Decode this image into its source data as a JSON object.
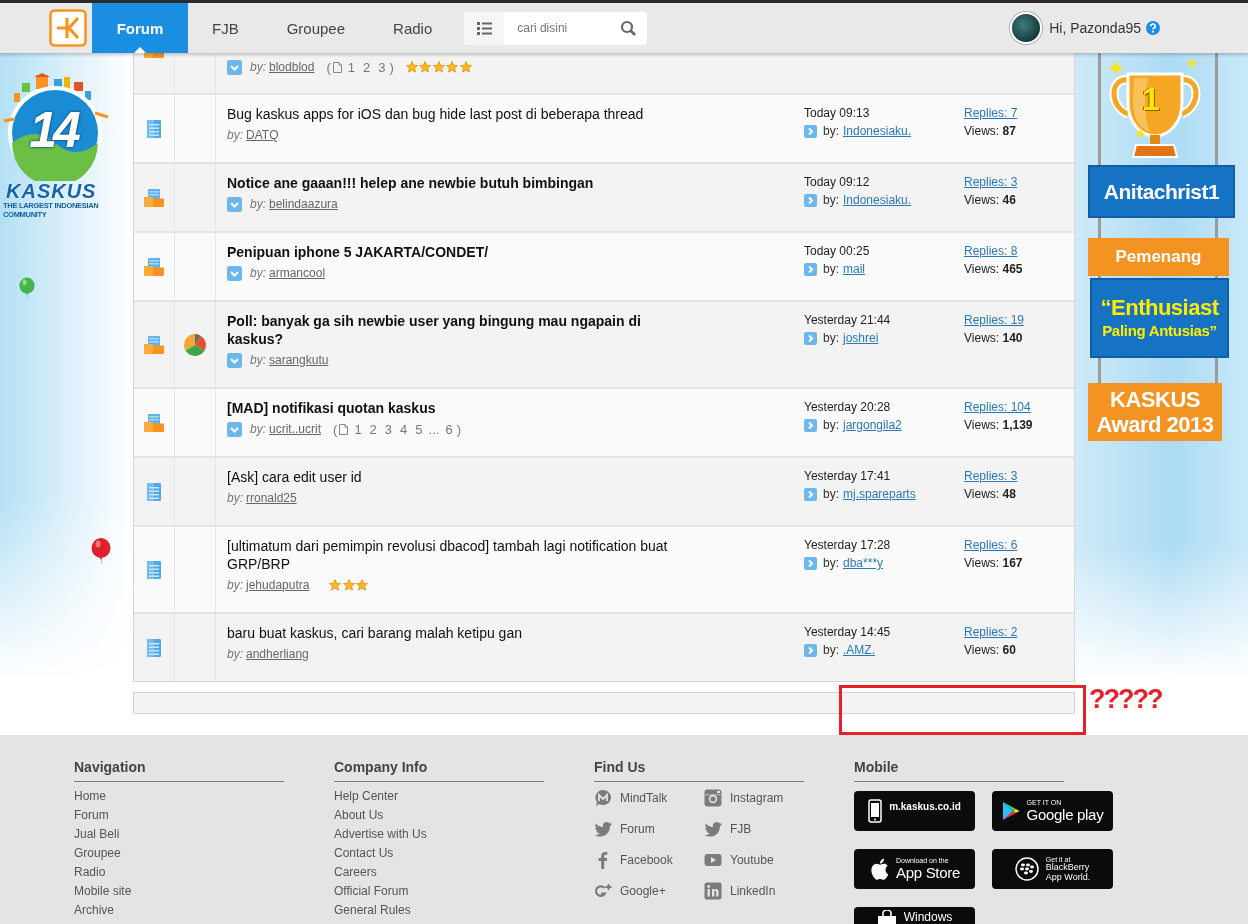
{
  "header": {
    "tabs": [
      {
        "label": "Forum",
        "selected": true
      },
      {
        "label": "FJB",
        "selected": false
      },
      {
        "label": "Groupee",
        "selected": false
      },
      {
        "label": "Radio",
        "selected": false
      }
    ],
    "search": {
      "placeholder": "cari disini"
    },
    "user": {
      "greeting": "Hi, Pazonda95"
    }
  },
  "left_logo": {
    "number": "14",
    "name": "KASKUS",
    "tagline": "THE LARGEST INDONESIAN COMMUNITY"
  },
  "threads": [
    {
      "kind": "folder",
      "partial": true,
      "poll": false,
      "unread": true,
      "author_label": "by:",
      "author": "blodblod",
      "pages": {
        "open": "(",
        "items": [
          "1",
          "2",
          "3"
        ],
        "close": ")"
      },
      "stars": 5
    },
    {
      "kind": "document",
      "partial": false,
      "poll": false,
      "unread": false,
      "title": "Bug kaskus apps for iOS dan bug hide last post di beberapa thread",
      "author_label": "by:",
      "author": "DATQ",
      "last_post": {
        "time": "Today 09:13",
        "label": "by:",
        "user": "Indonesiaku."
      },
      "replies": "Replies: 7",
      "views": "Views: **87**"
    },
    {
      "kind": "folder",
      "partial": false,
      "poll": false,
      "unread": true,
      "title": "Notice ane gaaan!!! helep ane newbie butuh bimbingan",
      "author_label": "by:",
      "author": "belindaazura",
      "last_post": {
        "time": "Today 09:12",
        "label": "by:",
        "user": "Indonesiaku."
      },
      "replies": "Replies: 3",
      "views": "Views: **46**"
    },
    {
      "kind": "folder",
      "partial": false,
      "poll": false,
      "unread": true,
      "title": "Penipuan iphone 5 JAKARTA/CONDET/",
      "author_label": "by:",
      "author": "armancool",
      "last_post": {
        "time": "Today 00:25",
        "label": "by:",
        "user": "mail"
      },
      "replies": "Replies: 8",
      "views": "Views: **465**"
    },
    {
      "kind": "folder",
      "partial": false,
      "poll": true,
      "unread": true,
      "title": "Poll: banyak ga sih newbie user yang bingung mau ngapain di kaskus?",
      "author_label": "by:",
      "author": "sarangkutu",
      "last_post": {
        "time": "Yesterday 21:44",
        "label": "by:",
        "user": "joshrei"
      },
      "replies": "Replies: 19",
      "views": "Views: **140**"
    },
    {
      "kind": "folder",
      "partial": false,
      "poll": false,
      "unread": true,
      "title": "[MAD] notifikasi quotan kaskus",
      "author_label": "by:",
      "author": "ucrit..ucrit",
      "pages": {
        "open": "(",
        "items": [
          "1",
          "2",
          "3",
          "4",
          "5"
        ],
        "ellipsis": "...",
        "last": "6",
        "close": ")"
      },
      "last_post": {
        "time": "Yesterday 20:28",
        "label": "by:",
        "user": "jargongila2"
      },
      "replies": "Replies: 104",
      "views": "Views: **1,139**"
    },
    {
      "kind": "document",
      "partial": false,
      "poll": false,
      "unread": false,
      "title": "[Ask] cara edit user id",
      "author_label": "by:",
      "author": "rronald25",
      "last_post": {
        "time": "Yesterday 17:41",
        "label": "by:",
        "user": "mj.spareparts"
      },
      "replies": "Replies: 3",
      "views": "Views: **48**"
    },
    {
      "kind": "document",
      "partial": false,
      "poll": false,
      "unread": false,
      "title": "[ultimatum dari pemimpin revolusi dbacod] tambah lagi notification buat GRP/BRP",
      "author_label": "by:",
      "author": "jehudaputra",
      "stars": 3,
      "last_post": {
        "time": "Yesterday 17:28",
        "label": "by:",
        "user": "dba***y"
      },
      "replies": "Replies: 6",
      "views": "Views: **167**"
    },
    {
      "kind": "document",
      "partial": false,
      "poll": false,
      "unread": false,
      "title": "baru buat kaskus, cari barang malah ketipu gan",
      "author_label": "by:",
      "author": "andherliang",
      "last_post": {
        "time": "Yesterday 14:45",
        "label": "by:",
        "user": ".AMZ."
      },
      "replies": "Replies: 2",
      "views": "Views: **60**"
    }
  ],
  "award_banner": {
    "rank": "1",
    "winner": "Anitachrist1",
    "title": "Pemenang",
    "award_lines": [
      "“Enthusiast",
      "Paling Antusias”"
    ],
    "event_lines": [
      "KASKUS",
      "Award 2013"
    ]
  },
  "annotation": {
    "text": "?????"
  },
  "footer": {
    "columns": [
      {
        "heading": "Navigation",
        "kind": "links",
        "links": [
          "Home",
          "Forum",
          "Jual Beli",
          "Groupee",
          "Radio",
          "Mobile site",
          "Archive"
        ]
      },
      {
        "heading": "Company Info",
        "kind": "links",
        "links": [
          "Help Center",
          "About Us",
          "Advertise with Us",
          "Contact Us",
          "Careers",
          "Official Forum",
          "General Rules"
        ]
      },
      {
        "heading": "Find Us",
        "kind": "social",
        "links": [
          {
            "label": "MindTalk",
            "kind": "mindtalk"
          },
          {
            "label": "Instagram",
            "kind": "camera"
          },
          {
            "label": "Forum",
            "kind": "bird"
          },
          {
            "label": "FJB",
            "kind": "bird"
          },
          {
            "label": "Facebook",
            "kind": "facebook"
          },
          {
            "label": "Youtube",
            "kind": "youtube"
          },
          {
            "label": "Google+",
            "kind": "googleplus"
          },
          {
            "label": "LinkedIn",
            "kind": "linkedin"
          }
        ]
      },
      {
        "heading": "Mobile",
        "kind": "badges",
        "badges": [
          {
            "kind": "phone",
            "lines": [
              "m.kaskus.co.id"
            ]
          },
          {
            "kind": "googleplay",
            "lines": [
              "GET IT ON",
              "Google play"
            ]
          },
          {
            "kind": "appstore",
            "lines": [
              "Download on the",
              "App Store"
            ]
          },
          {
            "kind": "blackberry",
            "lines": [
              "Get it at",
              "BlackBerry",
              "App World."
            ]
          },
          {
            "kind": "windows",
            "lines": [
              "Windows"
            ]
          }
        ]
      }
    ]
  }
}
